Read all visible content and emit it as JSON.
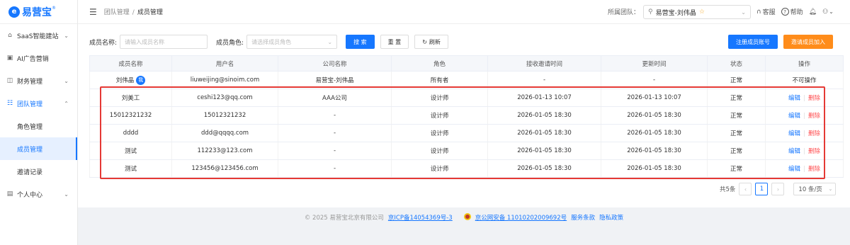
{
  "brand": {
    "name": "易营宝",
    "mark": "e",
    "registered": "®",
    "primary_color": "#1677ff"
  },
  "sidebar": {
    "items": [
      {
        "label": "SaaS智能建站",
        "icon": "home-icon",
        "expandable": true
      },
      {
        "label": "AI广告营销",
        "icon": "ad-icon",
        "expandable": false
      },
      {
        "label": "财务管理",
        "icon": "finance-icon",
        "expandable": true
      },
      {
        "label": "团队管理",
        "icon": "team-icon",
        "expandable": true,
        "expanded": true
      },
      {
        "label": "个人中心",
        "icon": "user-icon",
        "expandable": true
      }
    ],
    "team_sub_items": [
      {
        "label": "角色管理"
      },
      {
        "label": "成员管理",
        "selected": true
      },
      {
        "label": "邀请记录"
      }
    ]
  },
  "header": {
    "breadcrumb": [
      "团队管理",
      "成员管理"
    ],
    "breadcrumb_sep": "/",
    "team_label": "所属团队：",
    "team_value": "易营宝-刘伟晶",
    "service": "客服",
    "help": "帮助"
  },
  "filters": {
    "member_name_label": "成员名称:",
    "member_name_placeholder": "请输入成员名称",
    "role_label": "成员角色:",
    "role_placeholder": "请选择成员角色",
    "search_btn": "搜 索",
    "reset_btn": "重 置",
    "refresh_btn": "刷新",
    "register_btn": "注册成员账号",
    "invite_btn": "邀请成员加入"
  },
  "table": {
    "columns": [
      "成员名称",
      "用户名",
      "公司名称",
      "角色",
      "接收邀请时间",
      "更新时间",
      "状态",
      "操作"
    ],
    "owner_row": {
      "name": "刘伟晶",
      "me_badge": "我",
      "username": "liuweijing@sinoim.com",
      "company": "易营宝-刘伟晶",
      "role": "所有者",
      "accept_time": "-",
      "update_time": "-",
      "status": "正常",
      "op": "不可操作"
    },
    "rows": [
      {
        "name": "刘美工",
        "username": "ceshi123@qq.com",
        "company": "AAA公司",
        "role": "设计师",
        "accept_time": "2026-01-13 10:07",
        "update_time": "2026-01-13 10:07",
        "status": "正常"
      },
      {
        "name": "15012321232",
        "username": "15012321232",
        "company": "-",
        "role": "设计师",
        "accept_time": "2026-01-05 18:30",
        "update_time": "2026-01-05 18:30",
        "status": "正常"
      },
      {
        "name": "dddd",
        "username": "ddd@qqqq.com",
        "company": "-",
        "role": "设计师",
        "accept_time": "2026-01-05 18:30",
        "update_time": "2026-01-05 18:30",
        "status": "正常"
      },
      {
        "name": "测试",
        "username": "112233@123.com",
        "company": "-",
        "role": "设计师",
        "accept_time": "2026-01-05 18:30",
        "update_time": "2026-01-05 18:30",
        "status": "正常"
      },
      {
        "name": "测试",
        "username": "123456@123456.com",
        "company": "-",
        "role": "设计师",
        "accept_time": "2026-01-05 18:30",
        "update_time": "2026-01-05 18:30",
        "status": "正常"
      }
    ],
    "edit_label": "编辑",
    "delete_label": "删除",
    "op_sep": "|"
  },
  "pagination": {
    "total_text": "共5条",
    "current_page": "1",
    "page_size": "10 条/页"
  },
  "footer": {
    "copyright": "© 2025 易营宝北京有限公司",
    "icp": "京ICP备14054369号-3",
    "police": "京公网安备 11010202009692号",
    "terms": "服务条款",
    "privacy": "隐私政策"
  },
  "colors": {
    "status_ok": "#52c41a",
    "delete": "#ff4d4f",
    "invite": "#ff8c1a",
    "highlight": "#e53935"
  }
}
